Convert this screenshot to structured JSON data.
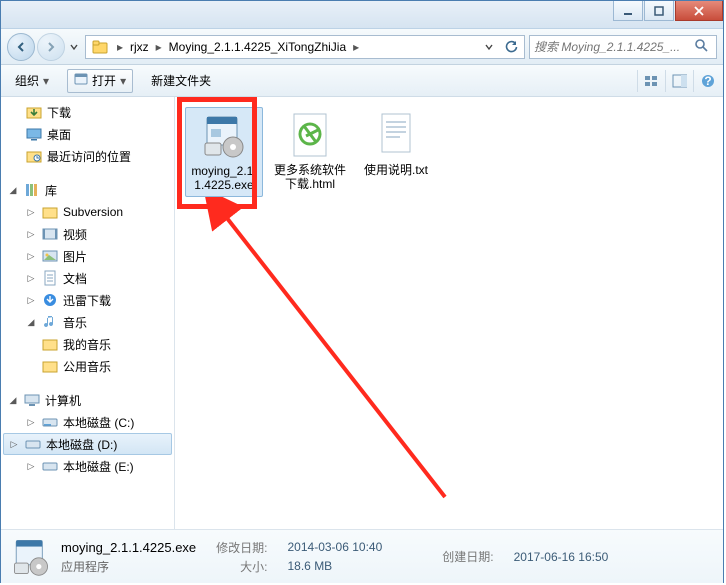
{
  "titlebar": {
    "min": "–",
    "max": "□",
    "close": "✕"
  },
  "nav": {
    "crumbs": [
      "rjxz",
      "Moying_2.1.1.4225_XiTongZhiJia"
    ],
    "search_placeholder": "搜索 Moying_2.1.1.4225_..."
  },
  "toolbar": {
    "organize": "组织",
    "open": "打开",
    "new_folder": "新建文件夹"
  },
  "sidebar": {
    "downloads": "下载",
    "desktop": "桌面",
    "recent": "最近访问的位置",
    "libraries": "库",
    "subversion": "Subversion",
    "videos": "视频",
    "pictures": "图片",
    "documents": "文档",
    "xunlei": "迅雷下载",
    "music": "音乐",
    "my_music": "我的音乐",
    "public_music": "公用音乐",
    "computer": "计算机",
    "disk_c": "本地磁盘 (C:)",
    "disk_d": "本地磁盘 (D:)",
    "disk_e": "本地磁盘 (E:)"
  },
  "files": [
    {
      "name": "moying_2.1.1.4225.exe",
      "type": "exe",
      "selected": true
    },
    {
      "name": "更多系统软件下载.html",
      "type": "html",
      "selected": false
    },
    {
      "name": "使用说明.txt",
      "type": "txt",
      "selected": false
    }
  ],
  "details": {
    "name": "moying_2.1.1.4225.exe",
    "type": "应用程序",
    "mod_label": "修改日期:",
    "mod_value": "2014-03-06 10:40",
    "size_label": "大小:",
    "size_value": "18.6 MB",
    "create_label": "创建日期:",
    "create_value": "2017-06-16 16:50"
  }
}
